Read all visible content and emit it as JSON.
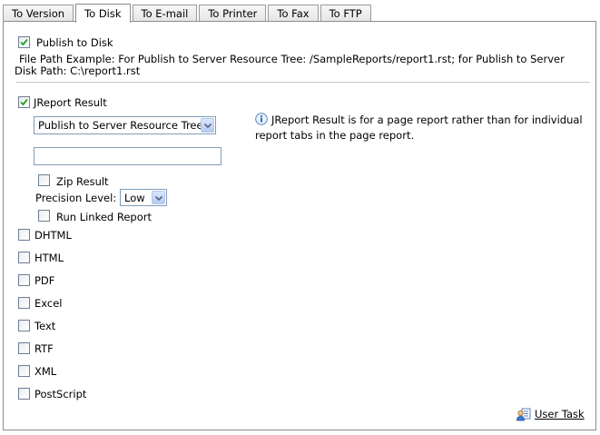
{
  "tabs": [
    {
      "label": "To Version",
      "active": false
    },
    {
      "label": "To Disk",
      "active": true
    },
    {
      "label": "To E-mail",
      "active": false
    },
    {
      "label": "To Printer",
      "active": false
    },
    {
      "label": "To Fax",
      "active": false
    },
    {
      "label": "To FTP",
      "active": false
    }
  ],
  "publish_to_disk": {
    "label": "Publish to Disk",
    "checked": true,
    "file_path_example_line1": "File Path Example: For Publish to Server Resource Tree: /SampleReports/report1.rst; for Publish to Server",
    "file_path_example_line2": "Disk Path: C:\\report1.rst"
  },
  "jreport_result": {
    "label": "JReport Result",
    "checked": true,
    "destination_select": "Publish to Server Resource Tree",
    "path_value": "",
    "zip_result": {
      "label": "Zip Result",
      "checked": false
    },
    "precision": {
      "label": "Precision Level:",
      "value": "Low"
    },
    "run_linked_report": {
      "label": "Run Linked Report",
      "checked": false
    },
    "info_line1": "JReport Result is for a page report rather than for individual",
    "info_line2": "report tabs in the page report."
  },
  "formats": [
    {
      "label": "DHTML",
      "checked": false
    },
    {
      "label": "HTML",
      "checked": false
    },
    {
      "label": "PDF",
      "checked": false
    },
    {
      "label": "Excel",
      "checked": false
    },
    {
      "label": "Text",
      "checked": false
    },
    {
      "label": "RTF",
      "checked": false
    },
    {
      "label": "XML",
      "checked": false
    },
    {
      "label": "PostScript",
      "checked": false
    }
  ],
  "user_task_link": "User Task"
}
